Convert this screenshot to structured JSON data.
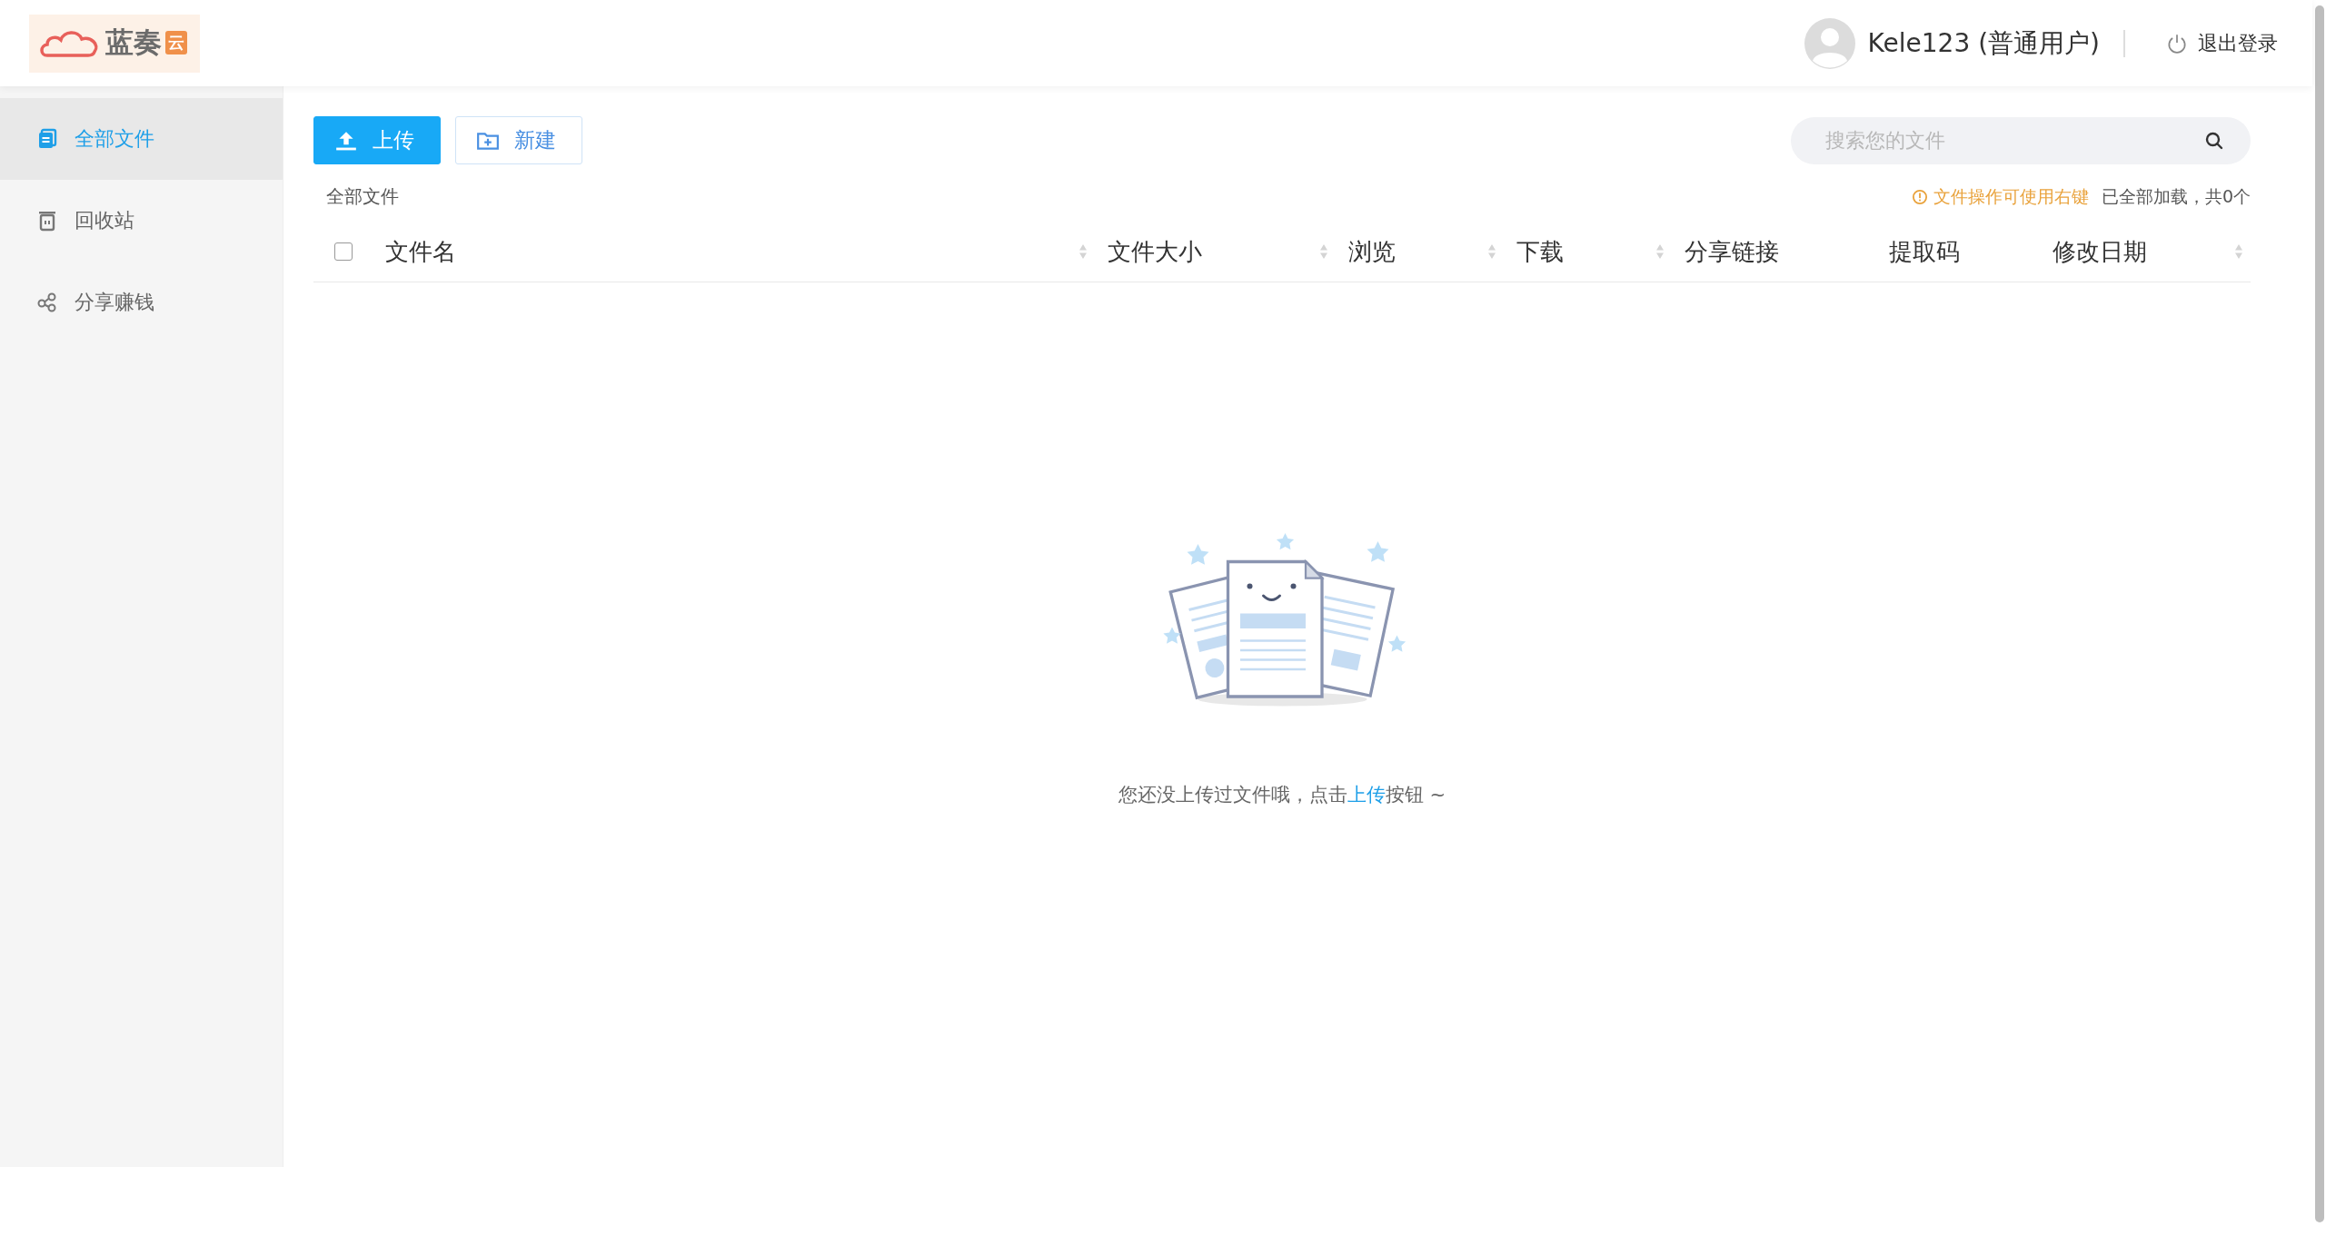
{
  "header": {
    "logo": {
      "text": "蓝奏",
      "badge": "云"
    },
    "user": {
      "name": "Kele123 (普通用户)"
    },
    "logout": "退出登录"
  },
  "sidebar": {
    "items": [
      {
        "label": "全部文件",
        "selected": true
      },
      {
        "label": "回收站",
        "selected": false
      },
      {
        "label": "分享赚钱",
        "selected": false
      }
    ]
  },
  "toolbar": {
    "buttons": [
      {
        "label": "上传",
        "kind": "primary"
      },
      {
        "label": "新建",
        "kind": "secondary"
      }
    ],
    "search": {
      "placeholder": "搜索您的文件"
    }
  },
  "breadcrumb": "全部文件",
  "tip": "文件操作可使用右键",
  "load_status": "已全部加载，共0个",
  "table": {
    "select_all": {
      "checked": false
    },
    "columns": [
      {
        "label": "文件名",
        "sortable": true
      },
      {
        "label": "文件大小",
        "sortable": true
      },
      {
        "label": "浏览",
        "sortable": true
      },
      {
        "label": "下载",
        "sortable": true
      },
      {
        "label": "分享链接",
        "sortable": false
      },
      {
        "label": "提取码",
        "sortable": false
      },
      {
        "label": "修改日期",
        "sortable": true
      }
    ]
  },
  "empty_state": {
    "before": "您还没上传过文件哦，点击",
    "link": "上传",
    "after": "按钮 ~"
  }
}
